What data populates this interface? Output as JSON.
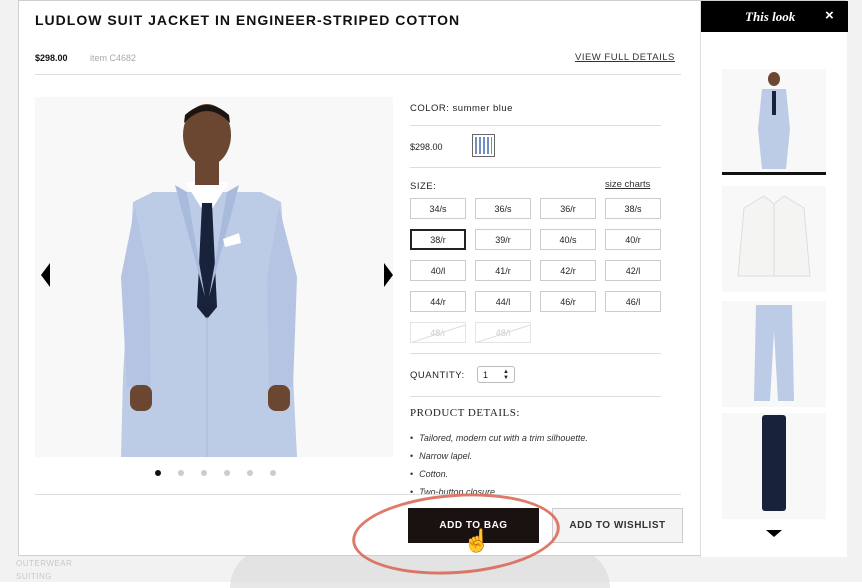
{
  "background": {
    "links": [
      "OUTERWEAR",
      "SUITING"
    ]
  },
  "product": {
    "title": "LUDLOW SUIT JACKET IN ENGINEER-STRIPED COTTON",
    "price": "$298.00",
    "item_number": "item C4682",
    "view_full_details": "VIEW FULL DETAILS"
  },
  "gallery": {
    "image_count": 6,
    "active_index": 0
  },
  "options": {
    "color_label": "COLOR: summer blue",
    "price": "$298.00",
    "size_label": "SIZE:",
    "size_charts": "size charts",
    "sizes": [
      {
        "label": "34/s",
        "state": "available"
      },
      {
        "label": "36/s",
        "state": "available"
      },
      {
        "label": "36/r",
        "state": "available"
      },
      {
        "label": "38/s",
        "state": "available"
      },
      {
        "label": "38/r",
        "state": "selected"
      },
      {
        "label": "39/r",
        "state": "available"
      },
      {
        "label": "40/s",
        "state": "available"
      },
      {
        "label": "40/r",
        "state": "available"
      },
      {
        "label": "40/l",
        "state": "available"
      },
      {
        "label": "41/r",
        "state": "available"
      },
      {
        "label": "42/r",
        "state": "available"
      },
      {
        "label": "42/l",
        "state": "available"
      },
      {
        "label": "44/r",
        "state": "available"
      },
      {
        "label": "44/l",
        "state": "available"
      },
      {
        "label": "46/r",
        "state": "available"
      },
      {
        "label": "46/l",
        "state": "available"
      },
      {
        "label": "48/r",
        "state": "disabled"
      },
      {
        "label": "48/l",
        "state": "disabled"
      }
    ],
    "quantity_label": "QUANTITY:",
    "quantity_value": "1"
  },
  "product_details": {
    "title": "PRODUCT DETAILS:",
    "items": [
      "Tailored, modern cut with a trim silhouette.",
      "Narrow lapel.",
      "Cotton.",
      "Two-button closure."
    ]
  },
  "actions": {
    "add_to_bag": "ADD TO BAG",
    "add_to_wishlist": "ADD TO WISHLIST"
  },
  "sidebar": {
    "title": "This look",
    "close": "×",
    "thumbnails": [
      "suit jacket look",
      "white oxford shirt",
      "striped suit pants",
      "navy knit tie"
    ]
  },
  "colors": {
    "suit": "#bccbe6",
    "tie": "#18223a",
    "skin": "#6b4630",
    "annotation": "#d9624f"
  }
}
